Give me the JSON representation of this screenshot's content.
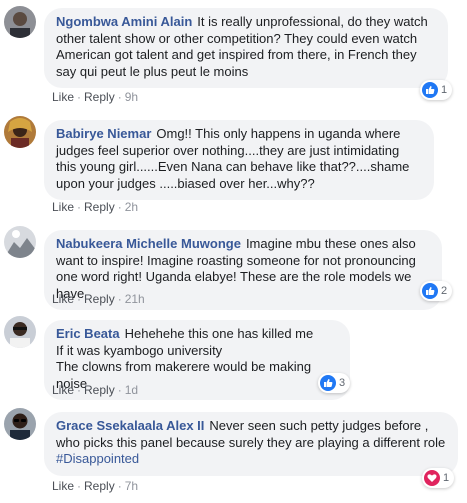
{
  "colors": {
    "author": "#385898",
    "bubble": "#f2f3f5",
    "like": "#2078f4",
    "love": "#e0245e",
    "meta": "#90949c"
  },
  "actions": {
    "like": "Like",
    "reply": "Reply",
    "separator": "·"
  },
  "comments": [
    {
      "author": "Ngombwa Amini Alain",
      "text": "It is really unprofessional, do they watch other talent show or other competition? They could even watch American got talent and get inspired from there, in French they say qui peut le plus peut le moins",
      "time": "9h",
      "reaction": {
        "icon": "like-icon",
        "count": "1"
      }
    },
    {
      "author": "Babirye Niemar",
      "text": "Omg!! This only happens in uganda where judges feel superior over nothing....they are just intimidating this young girl......Even Nana can behave like that??....shame upon your judges .....biased over her...why??",
      "time": "2h",
      "reaction": null
    },
    {
      "author": "Nabukeera Michelle Muwonge",
      "text": "Imagine mbu these ones also want to inspire! Imagine roasting someone for not pronouncing one word right! Uganda elabye! These are the role models we have",
      "time": "21h",
      "reaction": {
        "icon": "like-icon",
        "count": "2"
      }
    },
    {
      "author": "Eric Beata",
      "lines": [
        "Hehehehe this one has killed me",
        "If it was kyambogo university",
        "The clowns from makerere would be making noise"
      ],
      "time": "1d",
      "reaction": {
        "icon": "like-icon",
        "count": "3"
      }
    },
    {
      "author": "Grace Ssekalaala Alex II",
      "text": "Never seen such petty judges before , who picks this panel because surely they are playing a different role",
      "hashtag": "#Disappointed",
      "time": "7h",
      "reaction": {
        "icon": "love-icon",
        "count": "1"
      }
    }
  ]
}
